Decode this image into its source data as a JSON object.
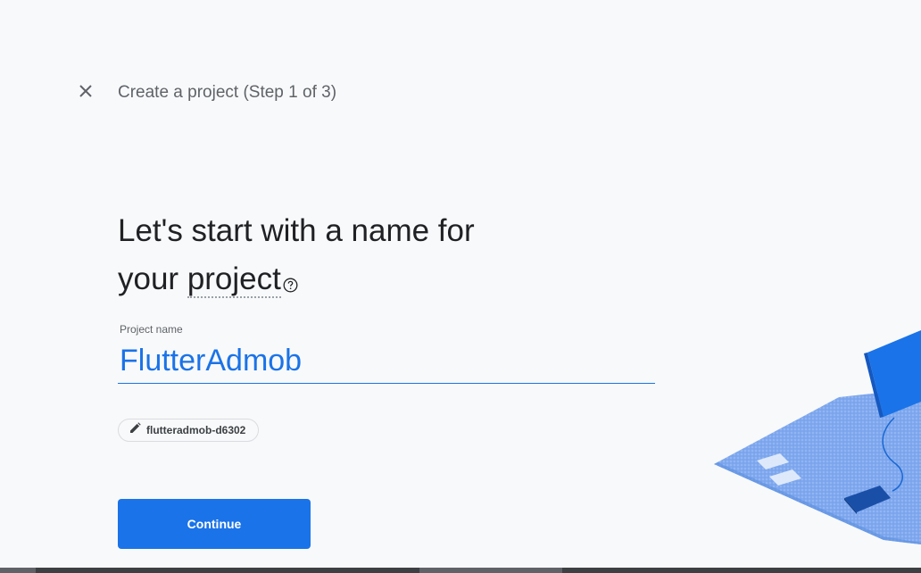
{
  "header": {
    "close_icon": "close-icon",
    "step_title": "Create a project (Step 1 of 3)"
  },
  "main": {
    "heading_line1": "Let's start with a name for",
    "heading_line2_prefix": "your ",
    "heading_term": "project",
    "help_icon": "help-circle-icon"
  },
  "project_name_field": {
    "label": "Project name",
    "value": "FlutterAdmob"
  },
  "project_id_chip": {
    "icon": "pencil-icon",
    "text": "flutteradmob-d6302"
  },
  "actions": {
    "continue_label": "Continue"
  },
  "colors": {
    "accent": "#1a73e8",
    "background": "#f8f9fa",
    "text_primary": "#202124",
    "text_secondary": "#5f6368"
  }
}
